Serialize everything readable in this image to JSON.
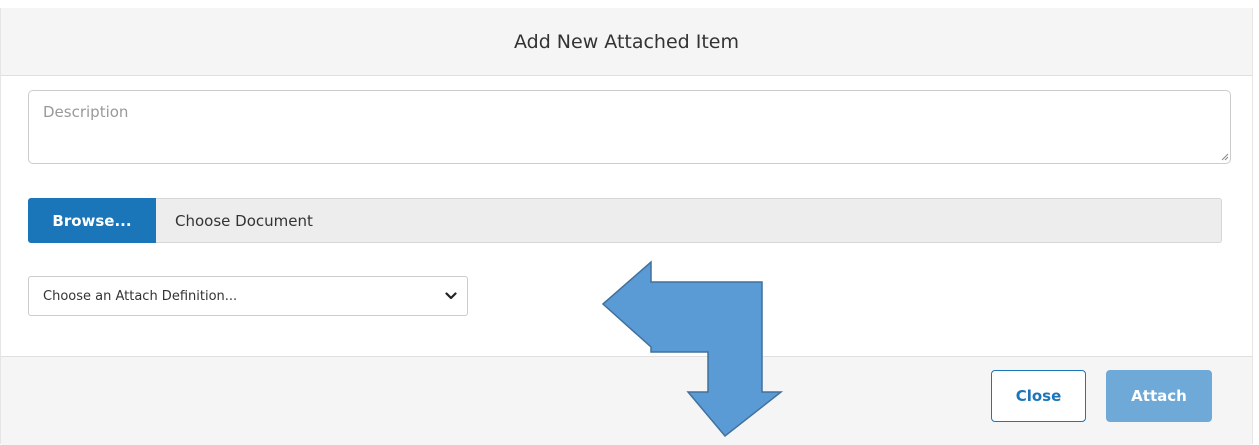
{
  "dialog": {
    "title": "Add New Attached Item"
  },
  "description": {
    "placeholder": "Description",
    "value": ""
  },
  "file_picker": {
    "browse_label": "Browse...",
    "file_text": "Choose Document"
  },
  "attach_definition": {
    "selected": "Choose an Attach Definition..."
  },
  "footer": {
    "close_label": "Close",
    "attach_label": "Attach"
  },
  "colors": {
    "primary": "#1a76b8",
    "attach_disabled": "#6fa9d8",
    "annotation_arrow": "#5b9bd5",
    "annotation_arrow_stroke": "#41719c"
  },
  "icons": {
    "select_caret": "chevron-down-icon",
    "annotation": "bent-arrow-icon"
  }
}
